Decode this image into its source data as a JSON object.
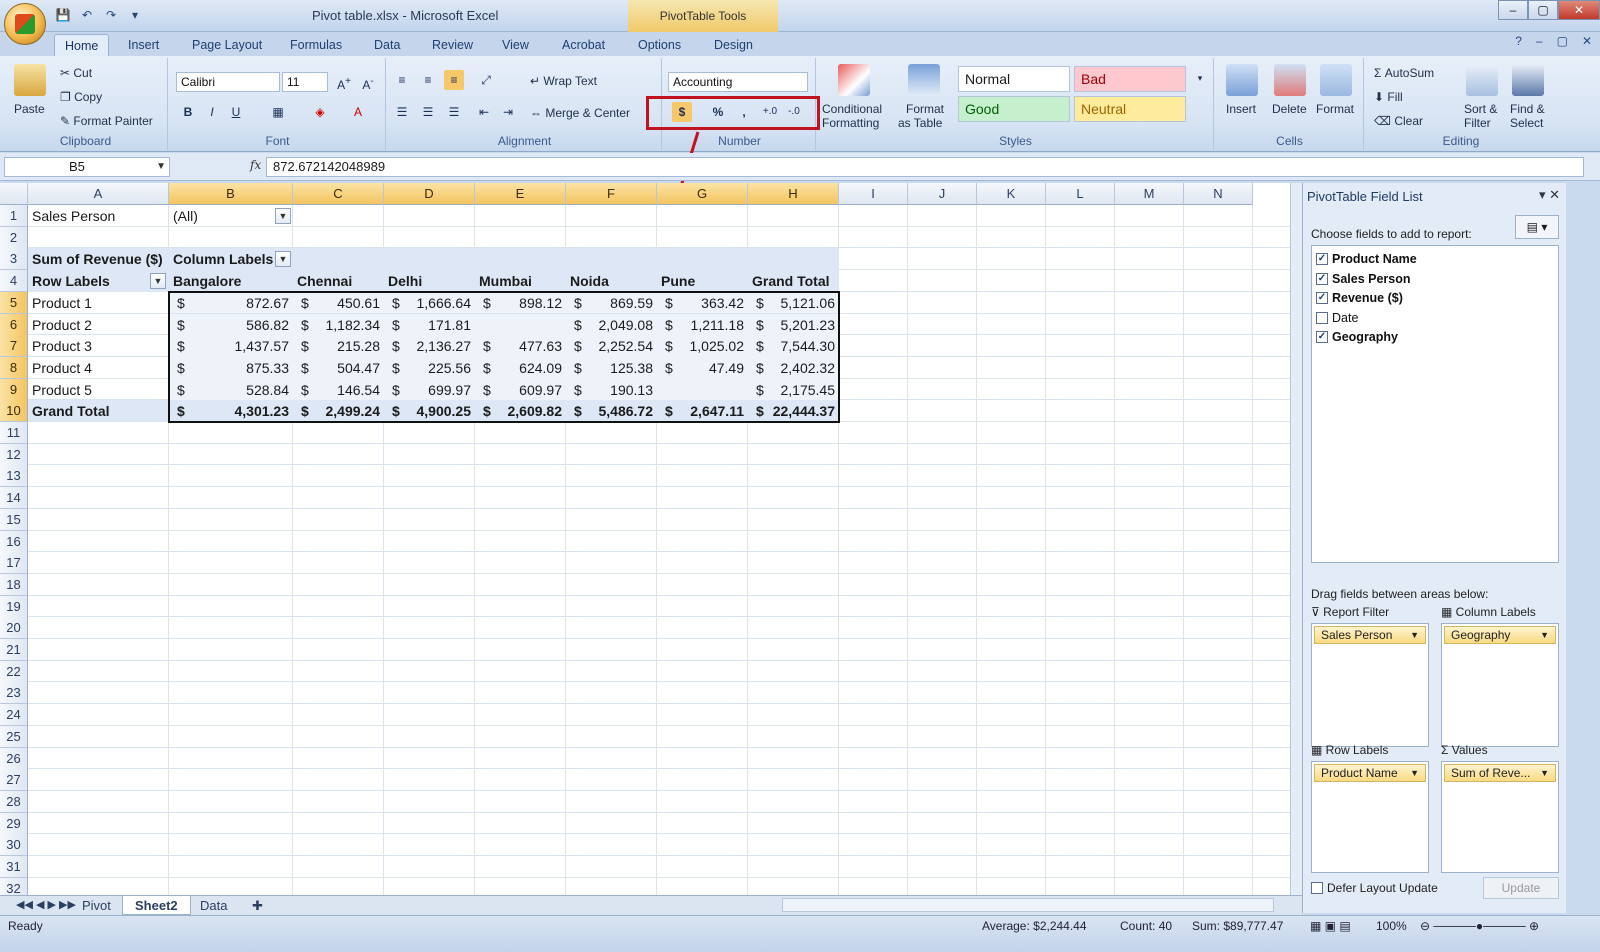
{
  "window": {
    "title": "Pivot table.xlsx - Microsoft Excel",
    "context_tab": "PivotTable Tools",
    "controls": [
      "–",
      "▢",
      "✕"
    ]
  },
  "qat": [
    "💾",
    "↶",
    "↷",
    "▾"
  ],
  "tabs": [
    "Home",
    "Insert",
    "Page Layout",
    "Formulas",
    "Data",
    "Review",
    "View",
    "Acrobat",
    "Options",
    "Design"
  ],
  "ribbon": {
    "clipboard": {
      "paste": "Paste",
      "cut": "Cut",
      "copy": "Copy",
      "format_painter": "Format Painter",
      "label": "Clipboard"
    },
    "font": {
      "name": "Calibri",
      "size": "11",
      "label": "Font",
      "bold": "B",
      "italic": "I",
      "underline": "U"
    },
    "alignment": {
      "wrap": "Wrap Text",
      "merge": "Merge & Center",
      "label": "Alignment"
    },
    "number": {
      "format": "Accounting",
      "currency": "$",
      "percent": "%",
      "comma": ",",
      "inc_dec": "+.0",
      "dec_dec": "-.0",
      "label": "Number"
    },
    "styles": {
      "conditional": "Conditional",
      "conditional2": "Formatting",
      "format_table": "Format",
      "format_table2": "as Table",
      "normal": "Normal",
      "bad": "Bad",
      "good": "Good",
      "neutral": "Neutral",
      "label": "Styles"
    },
    "cells": {
      "insert": "Insert",
      "delete": "Delete",
      "format": "Format",
      "label": "Cells"
    },
    "editing": {
      "autosum": "AutoSum",
      "fill": "Fill",
      "clear": "Clear",
      "sort": "Sort &",
      "sort2": "Filter",
      "find": "Find &",
      "find2": "Select",
      "label": "Editing"
    }
  },
  "formula_bar": {
    "name_box": "B5",
    "fx": "fx",
    "value": "872.672142048989"
  },
  "columns": [
    "A",
    "B",
    "C",
    "D",
    "E",
    "F",
    "G",
    "H",
    "I",
    "J",
    "K",
    "L",
    "M",
    "N"
  ],
  "rows": [
    "1",
    "2",
    "3",
    "4",
    "5",
    "6",
    "7",
    "8",
    "9",
    "10",
    "11",
    "12",
    "13",
    "14",
    "15",
    "16",
    "17",
    "18",
    "19",
    "20",
    "21",
    "22",
    "23",
    "24",
    "25",
    "26",
    "27",
    "28",
    "29",
    "30",
    "31",
    "32"
  ],
  "pivot": {
    "filter_label": "Sales Person",
    "filter_value": "(All)",
    "sum_label": "Sum of Revenue ($)",
    "col_labels": "Column Labels",
    "row_labels": "Row Labels",
    "headers": [
      "Bangalore",
      "Chennai",
      "Delhi",
      "Mumbai",
      "Noida",
      "Pune",
      "Grand Total"
    ],
    "data": [
      {
        "label": "Product 1",
        "values": [
          "872.67",
          "450.61",
          "1,666.64",
          "898.12",
          "869.59",
          "363.42",
          "5,121.06"
        ]
      },
      {
        "label": "Product 2",
        "values": [
          "586.82",
          "1,182.34",
          "171.81",
          "",
          "2,049.08",
          "1,211.18",
          "5,201.23"
        ]
      },
      {
        "label": "Product 3",
        "values": [
          "1,437.57",
          "215.28",
          "2,136.27",
          "477.63",
          "2,252.54",
          "1,025.02",
          "7,544.30"
        ]
      },
      {
        "label": "Product 4",
        "values": [
          "875.33",
          "504.47",
          "225.56",
          "624.09",
          "125.38",
          "47.49",
          "2,402.32"
        ]
      },
      {
        "label": "Product 5",
        "values": [
          "528.84",
          "146.54",
          "699.97",
          "609.97",
          "190.13",
          "",
          "2,175.45"
        ]
      }
    ],
    "total_label": "Grand Total",
    "totals": [
      "4,301.23",
      "2,499.24",
      "4,900.25",
      "2,609.82",
      "5,486.72",
      "2,647.11",
      "22,444.37"
    ],
    "currency": "$"
  },
  "sheet_tabs": [
    "Pivot",
    "Sheet2",
    "Data"
  ],
  "status": {
    "ready": "Ready",
    "average": "Average: $2,244.44",
    "count": "Count: 40",
    "sum": "Sum: $89,777.47",
    "zoom": "100%"
  },
  "field_list": {
    "title": "PivotTable Field List",
    "choose": "Choose fields to add to report:",
    "fields": [
      {
        "name": "Product Name",
        "checked": true
      },
      {
        "name": "Sales Person",
        "checked": true
      },
      {
        "name": "Revenue ($)",
        "checked": true
      },
      {
        "name": "Date",
        "checked": false
      },
      {
        "name": "Geography",
        "checked": true
      }
    ],
    "drag_label": "Drag fields between areas below:",
    "report_filter": "Report Filter",
    "column_labels": "Column Labels",
    "row_labels": "Row Labels",
    "values": "Values",
    "filter_chip": "Sales Person",
    "column_chip": "Geography",
    "row_chip": "Product Name",
    "values_chip": "Sum of Reve...",
    "defer": "Defer Layout Update",
    "update": "Update"
  }
}
